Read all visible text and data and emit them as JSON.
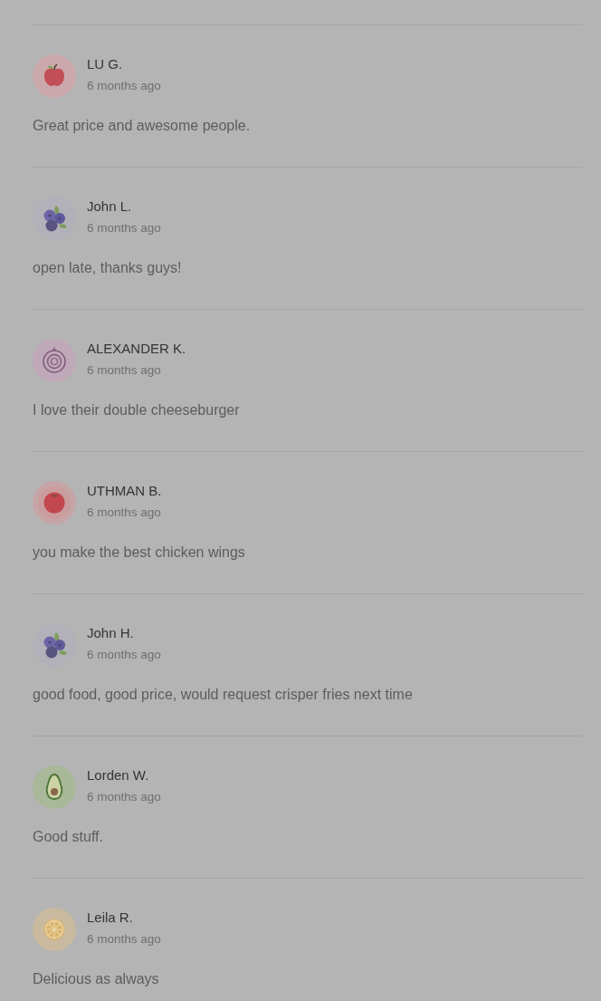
{
  "reviews": [
    {
      "author": "LU G.",
      "time": "6 months ago",
      "text": "Great price and awesome people.",
      "avatar": {
        "kind": "apple"
      }
    },
    {
      "author": "John L.",
      "time": "6 months ago",
      "text": "open late, thanks guys!",
      "avatar": {
        "kind": "blueberry"
      }
    },
    {
      "author": "ALEXANDER K.",
      "time": "6 months ago",
      "text": "I love their double cheeseburger",
      "avatar": {
        "kind": "onion"
      }
    },
    {
      "author": "UTHMAN B.",
      "time": "6 months ago",
      "text": "you make the best chicken wings",
      "avatar": {
        "kind": "tomato"
      }
    },
    {
      "author": "John H.",
      "time": "6 months ago",
      "text": "good food, good price, would request crisper fries next time",
      "avatar": {
        "kind": "blueberry"
      }
    },
    {
      "author": "Lorden W.",
      "time": "6 months ago",
      "text": "Good stuff.",
      "avatar": {
        "kind": "avocado"
      }
    },
    {
      "author": "Leila R.",
      "time": "6 months ago",
      "text": "Delicious as always",
      "avatar": {
        "kind": "lemon"
      }
    }
  ]
}
